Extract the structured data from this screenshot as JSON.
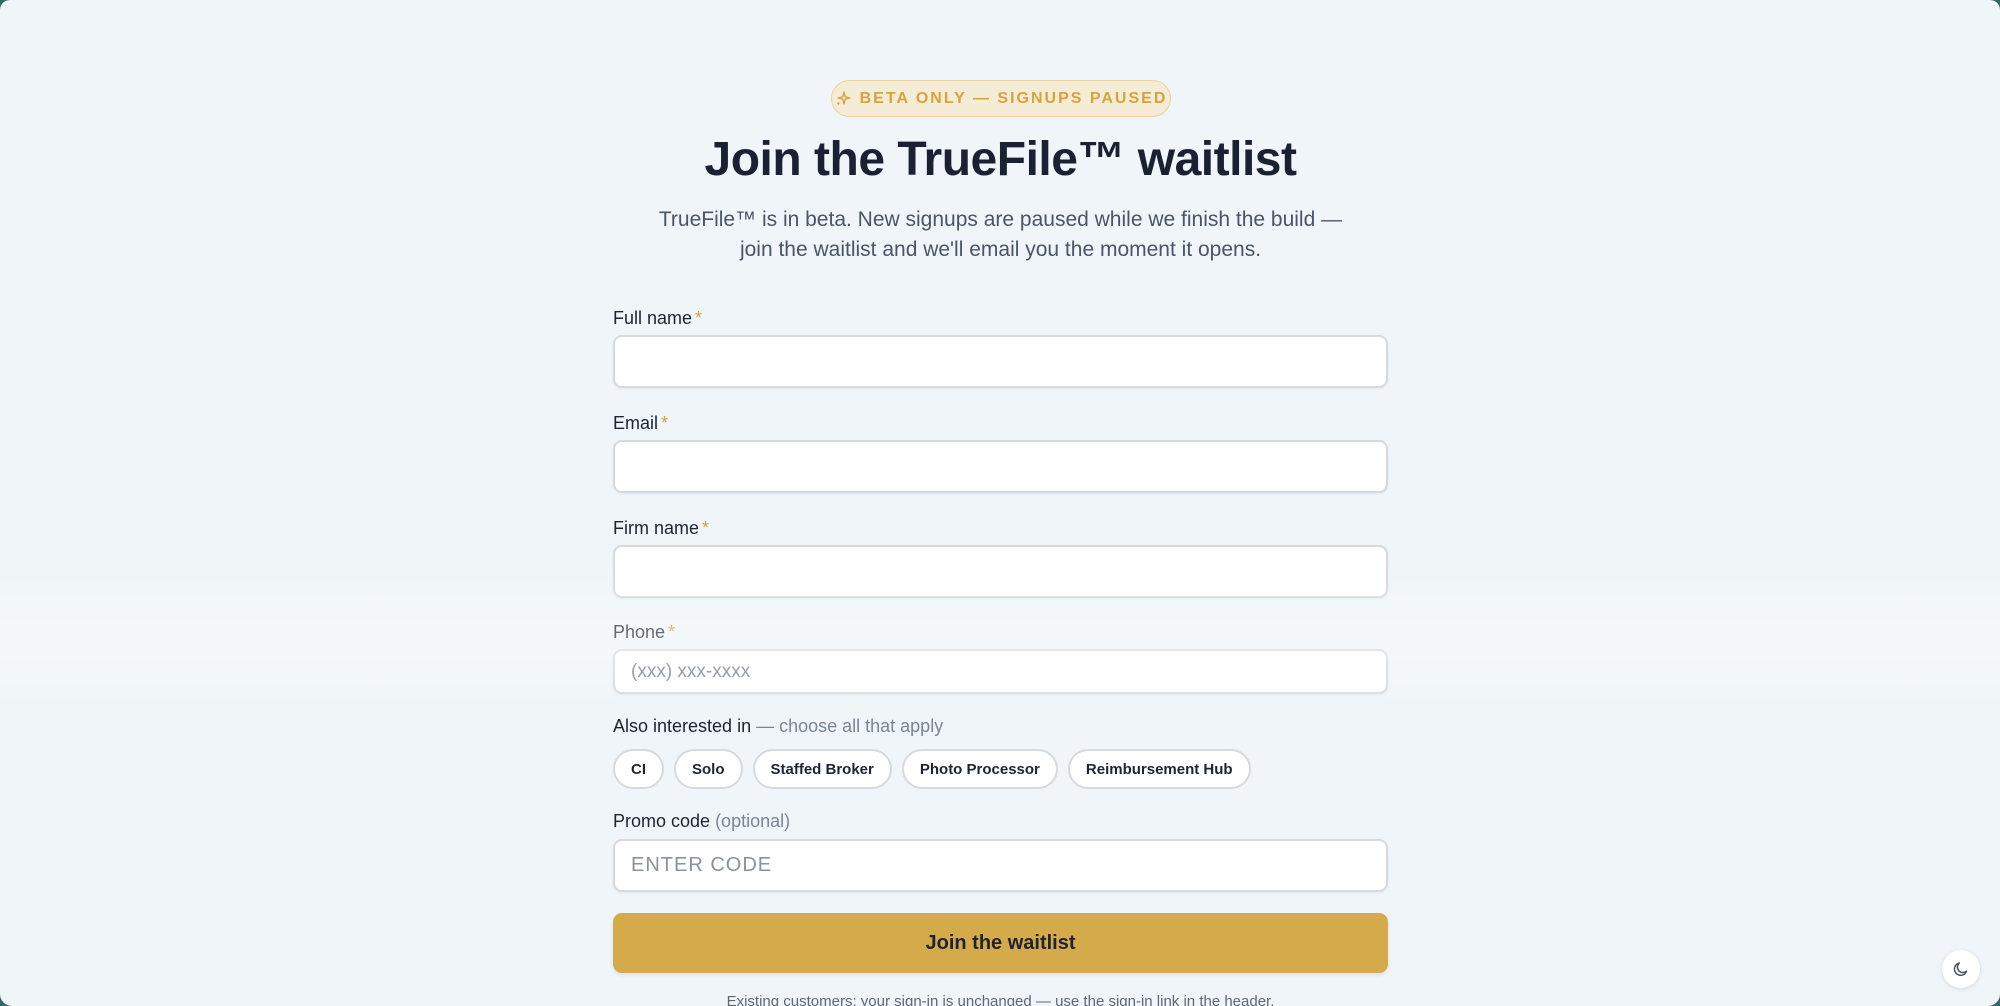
{
  "badge": {
    "text": "BETA ONLY — SIGNUPS PAUSED",
    "icon": "sparkle-icon",
    "color": "#d7a33d"
  },
  "title": "Join the TrueFile™ waitlist",
  "subtitle_line1": "TrueFile™ is in beta. New signups are paused while we finish the build —",
  "subtitle_line2": "join the waitlist and we'll email you the moment it opens.",
  "form": {
    "full_name": {
      "label": "Full name",
      "required_mark": "*",
      "value": ""
    },
    "email": {
      "label": "Email",
      "required_mark": "*",
      "value": ""
    },
    "firm_name": {
      "label": "Firm name",
      "required_mark": "*",
      "value": ""
    },
    "phone": {
      "label": "Phone",
      "required_mark": "*",
      "placeholder": "(xxx) xxx-xxxx",
      "value": ""
    },
    "interests": {
      "label": "Also interested in",
      "hint": " — choose all that apply",
      "options": [
        "CI",
        "Solo",
        "Staffed Broker",
        "Photo Processor",
        "Reimbursement Hub"
      ]
    },
    "promo": {
      "label": "Promo code",
      "hint": " (optional)",
      "placeholder": "ENTER CODE",
      "value": ""
    },
    "submit_label": "Join the waitlist"
  },
  "footnote": "Existing customers: your sign-in is unchanged — use the sign-in link in the header.",
  "theme_toggle": {
    "icon": "moon-icon"
  },
  "colors": {
    "accent": "#d4aa4a",
    "background": "#eff5f8",
    "text": "#192132"
  }
}
